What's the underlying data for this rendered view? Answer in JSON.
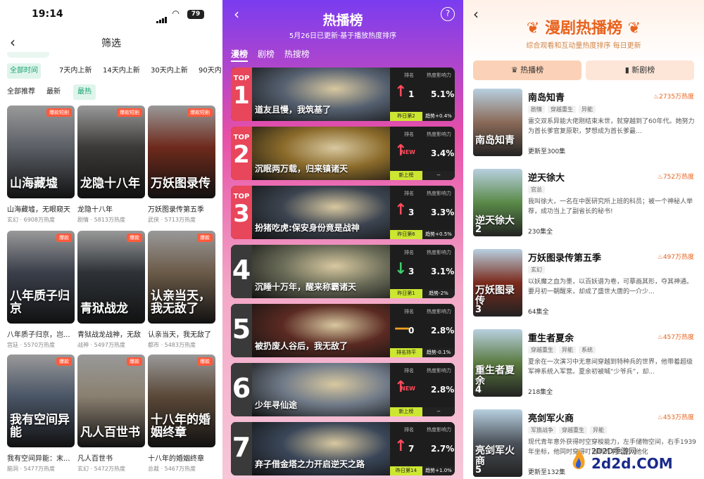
{
  "p1": {
    "time": "19:14",
    "battery": "79",
    "nav_title": "筛选",
    "time_tabs": [
      "全部时间",
      "7天内上新",
      "14天内上新",
      "30天内上新",
      "90天内"
    ],
    "sort_tabs": [
      "全部推荐",
      "最新",
      "最热"
    ],
    "cards": [
      {
        "name": "山海藏墟，无眼窥天",
        "meta": "玄幻 · 6908万热度",
        "tag": "爆款短剧",
        "poster_text": "山海藏墟",
        "bg": "#5b5f66"
      },
      {
        "name": "龙隐十八年",
        "meta": "剧情 · 5813万热度",
        "tag": "爆款短剧",
        "poster_text": "龙隐十八年",
        "bg": "#3b3a38"
      },
      {
        "name": "万妖图录传第五季",
        "meta": "武侠 · 5713万热度",
        "tag": "爆款短剧",
        "poster_text": "万妖图录传",
        "bg": "#6e2a1c"
      },
      {
        "name": "八年质子归京，岂...",
        "meta": "宫廷 · 5570万热度",
        "tag": "爆款",
        "poster_text": "八年质子归京",
        "bg": "#3a3f4a"
      },
      {
        "name": "青狱战龙战神，无敌",
        "meta": "战神 · 5497万热度",
        "tag": "爆款",
        "poster_text": "青狱战龙",
        "bg": "#2e3338"
      },
      {
        "name": "认亲当天，我无敌了",
        "meta": "都市 · 5483万热度",
        "tag": "爆款",
        "poster_text": "认亲当天，我无敌了",
        "bg": "#6b5a48"
      },
      {
        "name": "我有空间异能：末...",
        "meta": "脑洞 · 5477万热度",
        "tag": "爆款",
        "poster_text": "我有空间异能",
        "bg": "#4a5566"
      },
      {
        "name": "凡人百世书",
        "meta": "玄幻 · 5472万热度",
        "tag": "爆款",
        "poster_text": "凡人百世书",
        "bg": "#8a8070"
      },
      {
        "name": "十八年的婚姻终章",
        "meta": "总裁 · 5467万热度",
        "tag": "爆款",
        "poster_text": "十八年的婚姻终章",
        "bg": "#5a4838"
      }
    ]
  },
  "p2": {
    "title": "热播榜",
    "help": "?",
    "subtitle": "5月26日已更新·基于播放热度排序",
    "tabs": [
      "漫榜",
      "剧榜",
      "热搜榜"
    ],
    "col_rank": "排名",
    "col_hot": "热度影响力",
    "rows": [
      {
        "top": "TOP",
        "num": "1",
        "title": "道友且慢，我筑基了",
        "arrow": "↑",
        "new": "",
        "rank": "1",
        "pct": "5.1%",
        "foot_a": "昨日第2",
        "foot_b": "趋势+0.4%",
        "side": "#e8465a",
        "bg": "#556070",
        "arrow_color": "#ff4b5c"
      },
      {
        "top": "TOP",
        "num": "2",
        "title": "沉眠两万载，归来镇诸天",
        "arrow": "↑",
        "new": "NEW",
        "rank": "",
        "pct": "3.4%",
        "foot_a": "新上榜",
        "foot_b": "--",
        "side": "#e8465a",
        "bg": "#8a6a2a",
        "arrow_color": "#ff4b5c"
      },
      {
        "top": "TOP",
        "num": "3",
        "title": "扮猪吃虎:保安身份竟是战神",
        "arrow": "↑",
        "new": "",
        "rank": "3",
        "pct": "3.3%",
        "foot_a": "昨日第6",
        "foot_b": "趋势+0.5%",
        "side": "#e8465a",
        "bg": "#3c4450",
        "arrow_color": "#ff4b5c"
      },
      {
        "top": "",
        "num": "4",
        "title": "沉睡十万年，醒来称霸诸天",
        "arrow": "↓",
        "new": "",
        "rank": "3",
        "pct": "3.1%",
        "foot_a": "昨日第1",
        "foot_b": "趋势-2%",
        "side": "#3a3a3a",
        "bg": "#6a6c58",
        "arrow_color": "#3ecf6a"
      },
      {
        "top": "",
        "num": "5",
        "title": "被扔废人谷后，我无敌了",
        "arrow": "—",
        "new": "",
        "rank": "0",
        "pct": "2.8%",
        "foot_a": "排名持平",
        "foot_b": "趋势-0.1%",
        "side": "#3a3a3a",
        "bg": "#5a2a22",
        "arrow_color": "#f0a020"
      },
      {
        "top": "",
        "num": "6",
        "title": "少年寻仙途",
        "arrow": "↑",
        "new": "NEW",
        "rank": "",
        "pct": "2.8%",
        "foot_a": "新上榜",
        "foot_b": "--",
        "side": "#3a3a3a",
        "bg": "#707a88",
        "arrow_color": "#ff4b5c"
      },
      {
        "top": "",
        "num": "7",
        "title": "弃子借金塔之力开启逆天之路",
        "arrow": "↑",
        "new": "",
        "rank": "7",
        "pct": "2.7%",
        "foot_a": "昨日第14",
        "foot_b": "趋势+1.0%",
        "side": "#3a3a3a",
        "bg": "#3a4658",
        "arrow_color": "#ff4b5c"
      }
    ]
  },
  "p3": {
    "title": "漫剧热播榜",
    "subtitle": "综合观看和互动量热度排序 每日更新",
    "tab_hot": "热播榜",
    "tab_new": "新剧榜",
    "items": [
      {
        "title": "南岛知青",
        "hot": "2735万热度",
        "tags": [
          "剧情",
          "穿越重生",
          "异能"
        ],
        "desc": "雷交双系异能大佬刚结束末世，就穿越到了60年代。她努力为首长爹官复原职，梦想成为首长爹最...",
        "count": "更新至300集",
        "cover_text": "南岛知青",
        "ep": "",
        "bg": "#8a6a58"
      },
      {
        "title": "逆天徐大",
        "hot": "752万热度",
        "tags": [
          "官总"
        ],
        "desc": "我叫徐大，一名在中医研究所上班的科员；被一个神秘人举荐，成功当上了副省长的秘书!",
        "count": "230集全",
        "cover_text": "逆天徐大",
        "ep": "2",
        "bg": "#5a8a48"
      },
      {
        "title": "万妖图录传第五季",
        "hot": "497万热度",
        "tags": [
          "玄幻"
        ],
        "desc": "以妖魔之血为墨，以百妖谱为卷，可摹画其形，夺其神通。要月初一朝醒来，却成了盛世大唐的一介少...",
        "count": "64集全",
        "cover_text": "万妖图录传",
        "ep": "3",
        "bg": "#7a2a1c"
      },
      {
        "title": "重生者夏余",
        "hot": "457万热度",
        "tags": [
          "穿越重生",
          "异能",
          "系统"
        ],
        "desc": "夏余在一次演习中无意间穿越到特种兵的世界，他带着超级军神系统入军营。夏余初被喊“少爷兵”，却...",
        "count": "218集全",
        "cover_text": "重生者夏余",
        "ep": "4",
        "bg": "#5a7a40"
      },
      {
        "title": "亮剑军火商",
        "hot": "453万热度",
        "tags": [
          "军旅战争",
          "穿越重生",
          "异能"
        ],
        "desc": "现代青年意外获得时空穿梭能力，左手储物空间，右手1939年坐标，他同时穿得叮当响的李云龙...他化",
        "count": "更新至132集",
        "cover_text": "亮剑军火商",
        "ep": "5",
        "bg": "#4a5058"
      }
    ]
  },
  "watermark": {
    "line1": "2D2D手游网",
    "line2": "2d2d.COM"
  }
}
